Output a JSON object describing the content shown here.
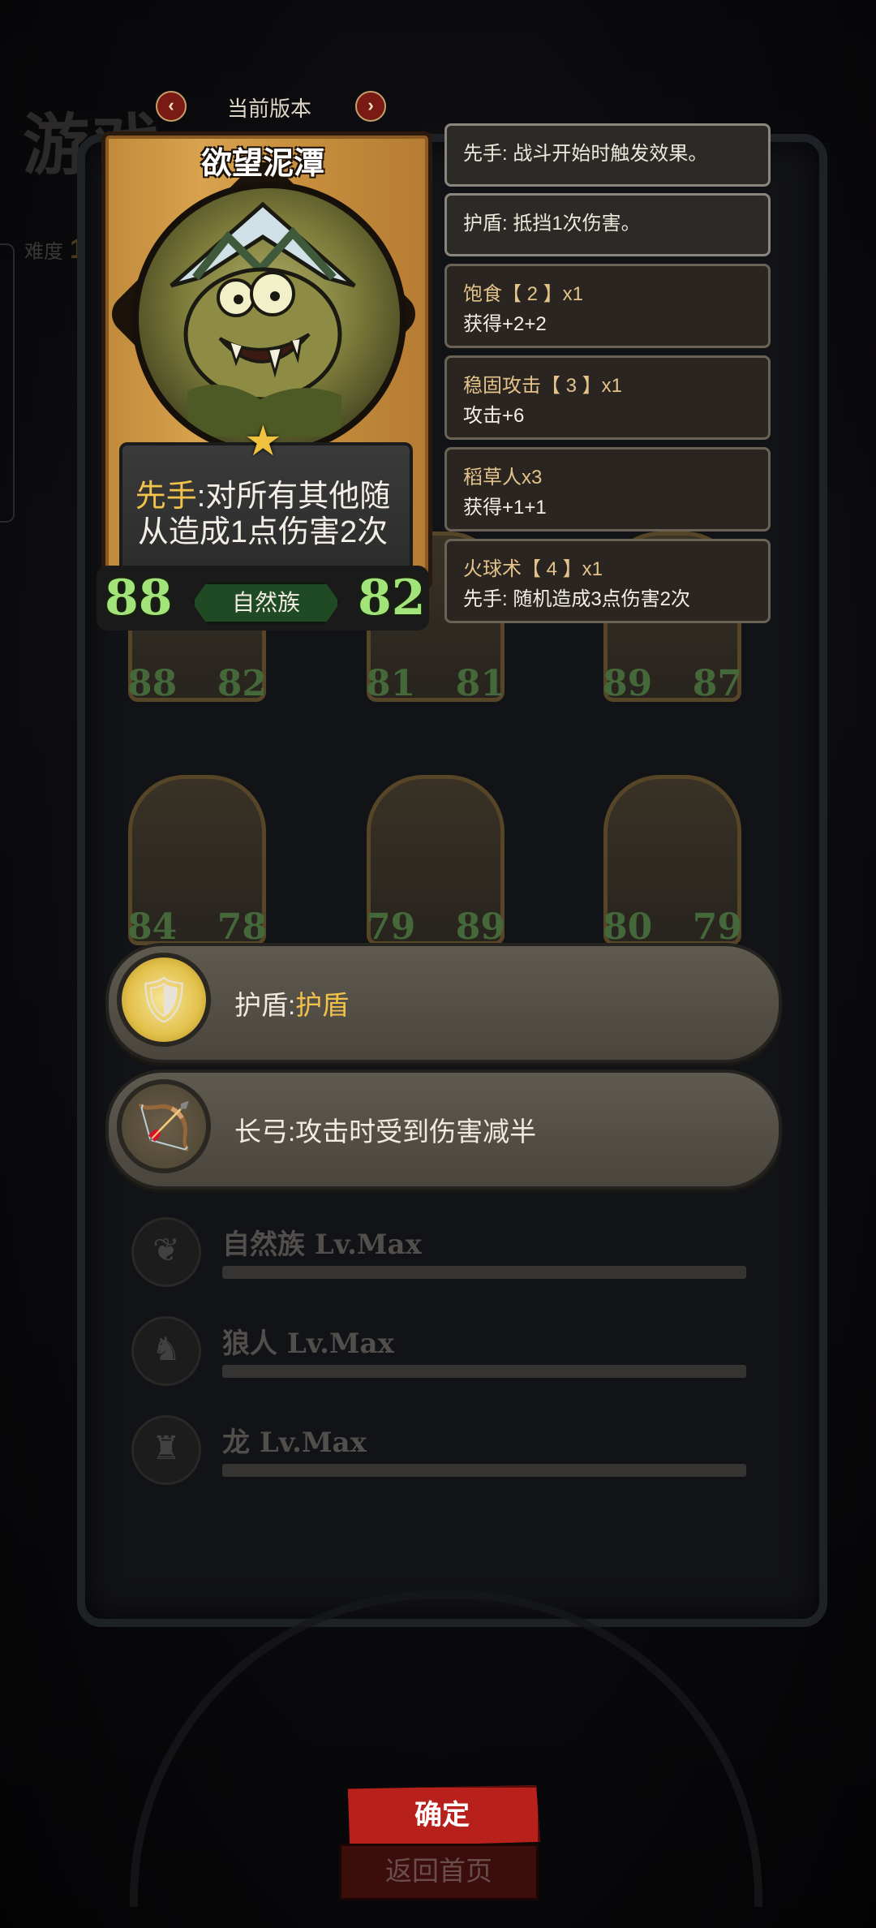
{
  "background": {
    "title_partial": "游戏",
    "difficulty_label": "难度",
    "difficulty_value": "1"
  },
  "version_nav": {
    "label": "当前版本",
    "prev_icon": "chevron-left-icon",
    "next_icon": "chevron-right-icon",
    "prev_glyph": "‹",
    "next_glyph": "›"
  },
  "card": {
    "name": "欲望泥潭",
    "keyword": "先手",
    "description_rest": ":对所有其他随从造成1点伤害2次",
    "attack": "88",
    "health": "82",
    "tribe": "自然族",
    "star_glyph": "★"
  },
  "tooltips": [
    {
      "kind": "keyword",
      "text": "先手: 战斗开始时触发效果。"
    },
    {
      "kind": "keyword",
      "text": "护盾: 抵挡1次伤害。"
    },
    {
      "kind": "item",
      "name": "饱食【 2 】x1",
      "effect": "获得+2+2"
    },
    {
      "kind": "item",
      "name": "稳固攻击【 3 】x1",
      "effect": "攻击+6"
    },
    {
      "kind": "item",
      "name": "稻草人x3",
      "effect": "获得+1+1"
    },
    {
      "kind": "item",
      "name": "火球术【 4 】x1",
      "effect": "先手: 随机造成3点伤害2次"
    }
  ],
  "grid_cards": [
    {
      "attack": "88",
      "health": "82"
    },
    {
      "attack": "81",
      "health": "81"
    },
    {
      "attack": "89",
      "health": "87"
    },
    {
      "attack": "84",
      "health": "78"
    },
    {
      "attack": "79",
      "health": "89"
    },
    {
      "attack": "80",
      "health": "79"
    }
  ],
  "abilities": [
    {
      "name": "护盾",
      "sep": ":",
      "value": "护盾",
      "icon": "shield-hero-icon",
      "glyph": "🛡"
    },
    {
      "name": "长弓",
      "sep": ":",
      "value": "攻击时受到伤害减半",
      "icon": "longbow-icon",
      "glyph": "🏹"
    }
  ],
  "levels": [
    {
      "label": "自然族 Lv.Max",
      "icon": "nature-emblem-icon",
      "glyph": "❦"
    },
    {
      "label": "狼人 Lv.Max",
      "icon": "werewolf-emblem-icon",
      "glyph": "♞"
    },
    {
      "label": "龙 Lv.Max",
      "icon": "dragon-emblem-icon",
      "glyph": "♜"
    }
  ],
  "buttons": {
    "confirm": "确定",
    "home": "返回首页"
  },
  "colors": {
    "keyword_gold": "#f2c34b",
    "stat_green": "#a2e37a",
    "confirm_red": "#b8201c",
    "tribe_green": "#1f4a24"
  }
}
